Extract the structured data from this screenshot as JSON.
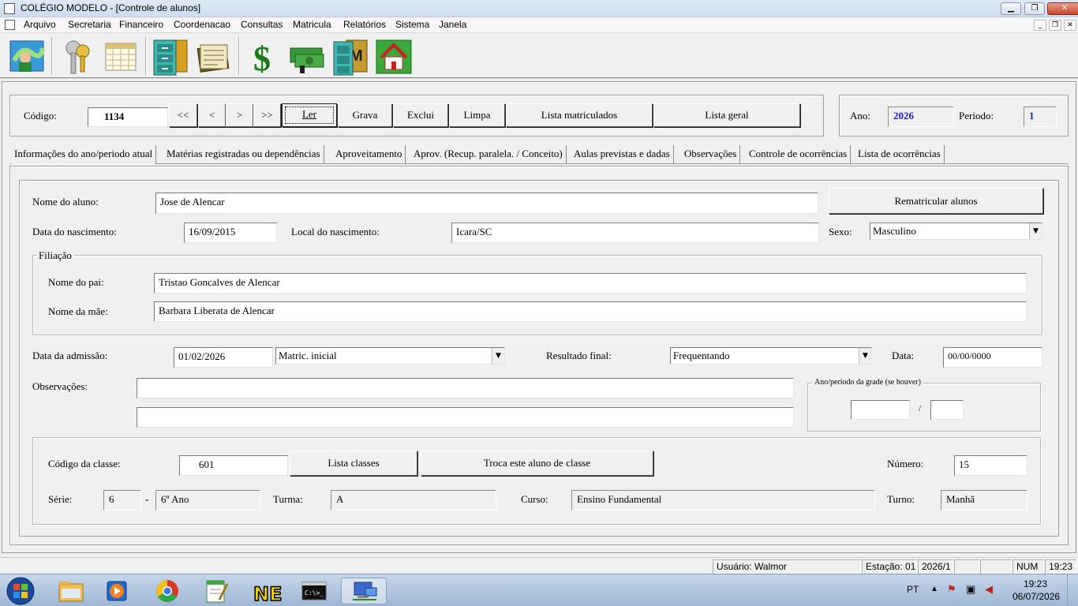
{
  "window": {
    "title": "COLÉGIO MODELO - [Controle de alunos]"
  },
  "menu": [
    "Arquivo",
    "Secretaria",
    "Financeiro",
    "Coordenacao",
    "Consultas",
    "Matricula",
    "Relatórios",
    "Sistema",
    "Janela"
  ],
  "toolbar_icons": [
    "students-map-icon",
    "keys-icon",
    "calendar-icon",
    "file-cabinet-icon",
    "documents-icon",
    "dollar-icon",
    "money-cash-icon",
    "cabinet-m-icon",
    "home-icon"
  ],
  "header": {
    "codigo_label": "Código:",
    "codigo_value": "1134",
    "nav": [
      "<<",
      "<",
      ">",
      ">>"
    ],
    "buttons": {
      "ler": "Ler",
      "grava": "Grava",
      "exclui": "Exclui",
      "limpa": "Limpa",
      "lista_matriculados": "Lista matriculados",
      "lista_geral": "Lista geral"
    },
    "ano_label": "Ano:",
    "ano_value": "2026",
    "periodo_label": "Periodo:",
    "periodo_value": "1"
  },
  "tabs": [
    "Informações do ano/periodo atual",
    "Matérias registradas ou dependências",
    "Aproveitamento",
    "Aprov. (Recup. paralela. / Conceito)",
    "Aulas previstas e dadas",
    "Observações",
    "Controle de ocorrências",
    "Lista de ocorrências"
  ],
  "form": {
    "nome_label": "Nome do aluno:",
    "nome_value": "Jose de Alencar",
    "rematricular": "Rematricular alunos",
    "nascimento_label": "Data do nascimento:",
    "nascimento_value": "16/09/2015",
    "local_label": "Local do nascimento:",
    "local_value": "Icara/SC",
    "sexo_label": "Sexo:",
    "sexo_value": "Masculino",
    "filiacao_title": "Filiação",
    "pai_label": "Nome do pai:",
    "pai_value": "Tristao Goncalves de Alencar",
    "mae_label": "Nome da mãe:",
    "mae_value": "Barbara Liberata de Alencar",
    "admissao_label": "Data da admissão:",
    "admissao_value": "01/02/2026",
    "matric_value": "Matric. inicial",
    "resultado_label": "Resultado final:",
    "resultado_value": "Frequentando",
    "data_label": "Data:",
    "data_value": "00/00/0000",
    "observacoes_label": "Observações:",
    "obs1": "",
    "obs2": "",
    "grade_title": "Ano/periodo da grade (se houver)",
    "grade_ano": "",
    "grade_sep": "/",
    "grade_periodo": ""
  },
  "classe": {
    "codigo_label": "Código da classe:",
    "codigo_value": "601",
    "lista_classes": "Lista classes",
    "troca": "Troca este aluno de classe",
    "numero_label": "Número:",
    "numero_value": "15",
    "serie_label": "Série:",
    "serie_value": "6",
    "serie_dash": "-",
    "serie_desc": "6º Ano",
    "turma_label": "Turma:",
    "turma_value": "A",
    "curso_label": "Curso:",
    "curso_value": "Ensino Fundamental",
    "turno_label": "Turno:",
    "turno_value": "Manhã"
  },
  "status": {
    "usuario": "Usuário: Walmor",
    "estacao": "Estação: 01",
    "periodo": "2026/1",
    "num": "NUM",
    "hora": "19:23"
  },
  "taskbar": {
    "lang": "PT",
    "time": "19:23",
    "date": "06/07/2026",
    "apps": [
      "explorer-icon",
      "media-player-icon",
      "chrome-icon",
      "notepad-icon",
      "ne-app-icon",
      "console-icon",
      "network-app-icon"
    ]
  },
  "colors": {
    "accent_blue": "#1a1ad0",
    "title_bar": "#dfe9f5",
    "taskbar": "#b4c9e2"
  }
}
